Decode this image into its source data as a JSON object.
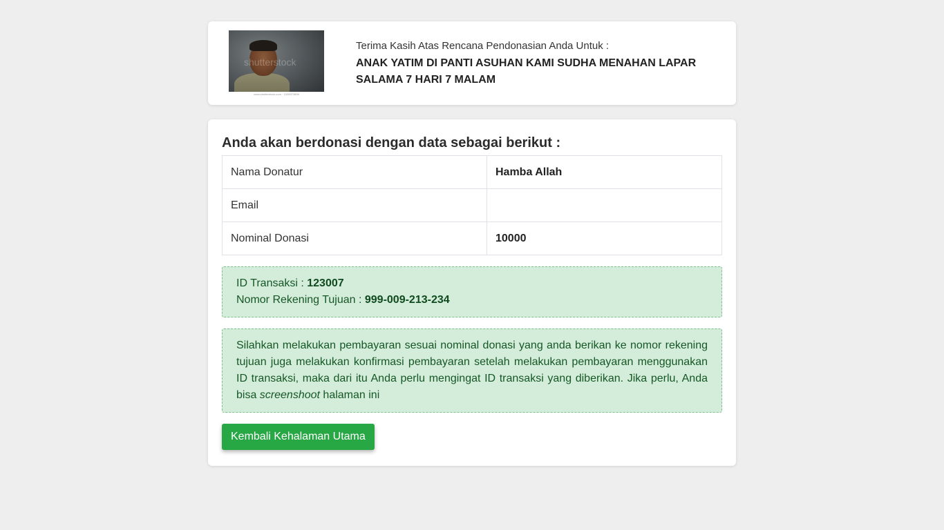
{
  "header": {
    "image_alt": "shutterstock",
    "image_caption": "www.shutterstock.com · 1328573896",
    "intro": "Terima Kasih Atas Rencana Pendonasian Anda Untuk :",
    "campaign_title": "ANAK YATIM DI PANTI ASUHAN KAMI SUDHA MENAHAN LAPAR SALAMA 7 HARI 7 MALAM"
  },
  "main": {
    "heading": "Anda akan berdonasi dengan data sebagai berikut :",
    "rows": [
      {
        "label": "Nama Donatur",
        "value": "Hamba Allah"
      },
      {
        "label": "Email",
        "value": ""
      },
      {
        "label": "Nominal Donasi",
        "value": "10000"
      }
    ],
    "transaction": {
      "id_label": "ID Transaksi : ",
      "id_value": "123007",
      "account_label": "Nomor Rekening Tujuan : ",
      "account_value": "999-009-213-234"
    },
    "note": {
      "text_before": "Silahkan melakukan pembayaran sesuai nominal donasi yang anda berikan ke nomor rekening tujuan juga melakukan konfirmasi pembayaran setelah melakukan pembayaran menggunakan ID transaksi, maka dari itu Anda perlu mengingat ID transaksi yang diberikan. Jika perlu, Anda bisa ",
      "text_italic": "screenshoot",
      "text_after": " halaman ini"
    },
    "back_button": "Kembali Kehalaman Utama"
  },
  "colors": {
    "page_background": "#eeeeee",
    "alert_background": "#d4edda",
    "alert_text": "#155724",
    "button_background": "#28a745"
  }
}
